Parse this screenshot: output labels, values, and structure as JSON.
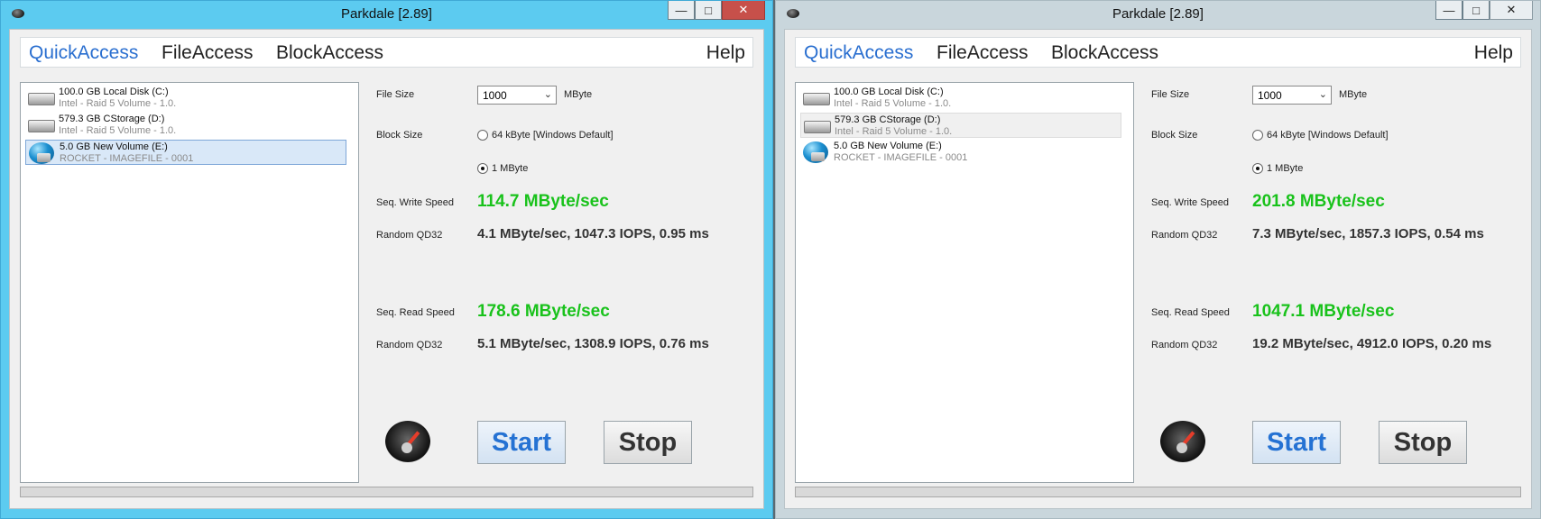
{
  "windows": [
    {
      "title": "Parkdale [2.89]",
      "tabs": [
        "QuickAccess",
        "FileAccess",
        "BlockAccess"
      ],
      "help": "Help",
      "disks": [
        {
          "name": "100.0 GB Local Disk (C:)",
          "sub": "Intel - Raid 5 Volume - 1.0.",
          "icon": "disk-icon"
        },
        {
          "name": "579.3 GB CStorage (D:)",
          "sub": "Intel - Raid 5 Volume - 1.0.",
          "icon": "disk-icon"
        },
        {
          "name": "5.0 GB New Volume (E:)",
          "sub": "ROCKET - IMAGEFILE - 0001",
          "icon": "globe-disk-icon"
        }
      ],
      "file_size_label": "File Size",
      "file_size_value": "1000",
      "file_size_unit": "MByte",
      "block_size_label": "Block Size",
      "block_option_1": "64 kByte [Windows Default]",
      "block_option_2": "1 MByte",
      "seq_write_label": "Seq. Write Speed",
      "seq_write_value": "114.7 MByte/sec",
      "random_write_label": "Random QD32",
      "random_write_value": "4.1 MByte/sec, 1047.3 IOPS, 0.95 ms",
      "seq_read_label": "Seq. Read Speed",
      "seq_read_value": "178.6 MByte/sec",
      "random_read_label": "Random QD32",
      "random_read_value": "5.1 MByte/sec, 1308.9 IOPS, 0.76 ms",
      "start_label": "Start",
      "stop_label": "Stop",
      "progress": 0
    },
    {
      "title": "Parkdale [2.89]",
      "tabs": [
        "QuickAccess",
        "FileAccess",
        "BlockAccess"
      ],
      "help": "Help",
      "disks": [
        {
          "name": "100.0 GB Local Disk (C:)",
          "sub": "Intel - Raid 5 Volume - 1.0.",
          "icon": "disk-icon"
        },
        {
          "name": "579.3 GB CStorage (D:)",
          "sub": "Intel - Raid 5 Volume - 1.0.",
          "icon": "disk-icon"
        },
        {
          "name": "5.0 GB New Volume (E:)",
          "sub": "ROCKET - IMAGEFILE - 0001",
          "icon": "globe-disk-icon"
        }
      ],
      "file_size_label": "File Size",
      "file_size_value": "1000",
      "file_size_unit": "MByte",
      "block_size_label": "Block Size",
      "block_option_1": "64 kByte [Windows Default]",
      "block_option_2": "1 MByte",
      "seq_write_label": "Seq. Write Speed",
      "seq_write_value": "201.8 MByte/sec",
      "random_write_label": "Random QD32",
      "random_write_value": "7.3 MByte/sec, 1857.3 IOPS, 0.54 ms",
      "seq_read_label": "Seq. Read Speed",
      "seq_read_value": "1047.1 MByte/sec",
      "random_read_label": "Random QD32",
      "random_read_value": "19.2 MByte/sec, 4912.0 IOPS, 0.20 ms",
      "start_label": "Start",
      "stop_label": "Stop",
      "progress": 0
    }
  ],
  "colors": {
    "active_title": "#5ccbf0",
    "inactive_title": "#c9d6dc",
    "speed_green": "#19c21b",
    "tab_active": "#2a6fd0",
    "start_text": "#2572d3"
  }
}
